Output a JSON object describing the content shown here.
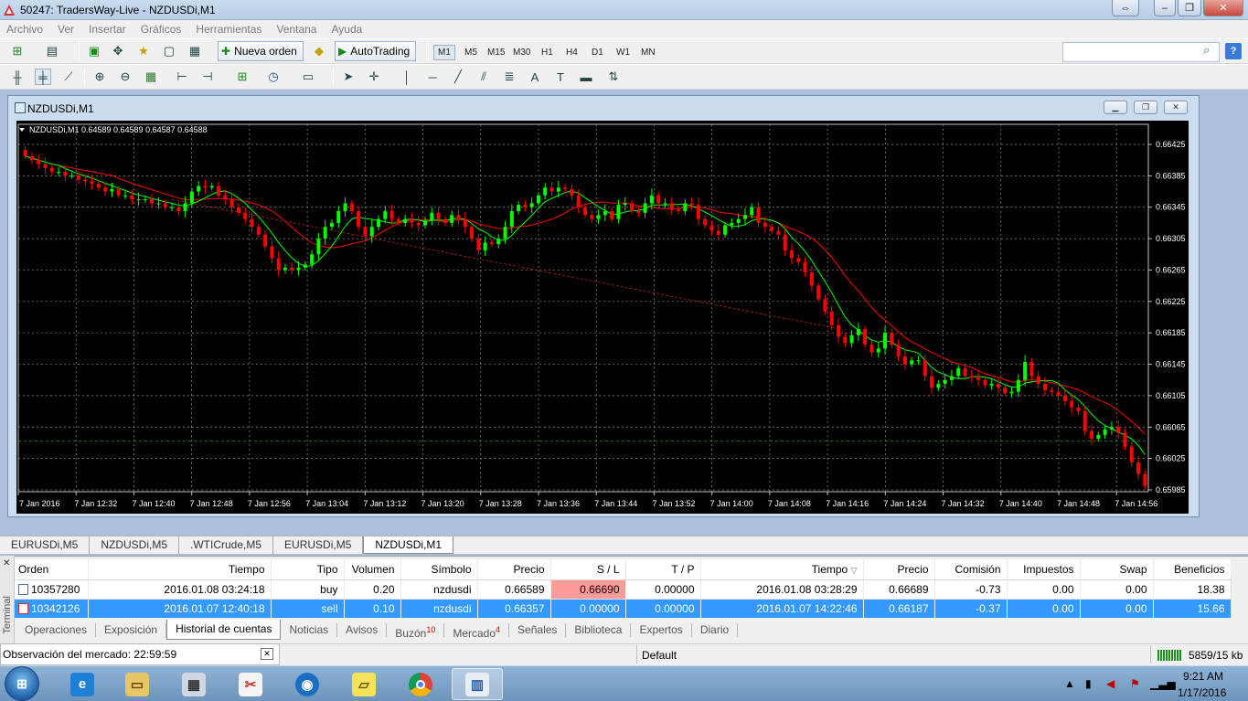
{
  "window": {
    "title": "50247: TradersWay-Live - NZDUSDi,M1"
  },
  "menu": [
    "Archivo",
    "Ver",
    "Insertar",
    "Gráficos",
    "Herramientas",
    "Ventana",
    "Ayuda"
  ],
  "toolbar": {
    "new_order": "Nueva orden",
    "autotrading": "AutoTrading",
    "timeframes": [
      "M1",
      "M5",
      "M15",
      "M30",
      "H1",
      "H4",
      "D1",
      "W1",
      "MN"
    ],
    "active_timeframe": "M1"
  },
  "chart_window": {
    "title": "NZDUSDi,M1"
  },
  "chart_data": {
    "type": "candlestick",
    "header": "NZDUSDi,M1  0.64589 0.64589 0.64587 0.64588",
    "symbol": "NZDUSDi,M1",
    "ohlc_shown": [
      0.64589,
      0.64589,
      0.64587,
      0.64588
    ],
    "y_ticks": [
      "0.66425",
      "0.66385",
      "0.66345",
      "0.66305",
      "0.66265",
      "0.66225",
      "0.66185",
      "0.66145",
      "0.66105",
      "0.66065",
      "0.66025",
      "0.65985"
    ],
    "ylim": [
      0.65985,
      0.66425
    ],
    "x_ticks": [
      "7 Jan 2016",
      "7 Jan 12:32",
      "7 Jan 12:40",
      "7 Jan 12:48",
      "7 Jan 12:56",
      "7 Jan 13:04",
      "7 Jan 13:12",
      "7 Jan 13:20",
      "7 Jan 13:28",
      "7 Jan 13:36",
      "7 Jan 13:44",
      "7 Jan 13:52",
      "7 Jan 14:00",
      "7 Jan 14:08",
      "7 Jan 14:16",
      "7 Jan 14:24",
      "7 Jan 14:32",
      "7 Jan 14:40",
      "7 Jan 14:48",
      "7 Jan 14:56"
    ],
    "close_series": [
      0.6641,
      0.66405,
      0.664,
      0.66395,
      0.6639,
      0.6639,
      0.66385,
      0.66385,
      0.6638,
      0.66378,
      0.66375,
      0.6637,
      0.66365,
      0.66368,
      0.6636,
      0.6636,
      0.66355,
      0.66355,
      0.66355,
      0.6635,
      0.6635,
      0.66345,
      0.66345,
      0.6634,
      0.6635,
      0.66365,
      0.66372,
      0.6637,
      0.66372,
      0.6636,
      0.66355,
      0.66345,
      0.66338,
      0.6633,
      0.6632,
      0.6631,
      0.66295,
      0.6628,
      0.66265,
      0.66268,
      0.66265,
      0.66268,
      0.66272,
      0.66285,
      0.66305,
      0.6632,
      0.66325,
      0.6634,
      0.6635,
      0.6634,
      0.6632,
      0.66308,
      0.6632,
      0.6633,
      0.6634,
      0.6633,
      0.66325,
      0.6633,
      0.66325,
      0.66322,
      0.66328,
      0.66338,
      0.6633,
      0.66325,
      0.66335,
      0.6633,
      0.6632,
      0.66305,
      0.6629,
      0.663,
      0.66298,
      0.66305,
      0.6632,
      0.6634,
      0.66348,
      0.66345,
      0.6635,
      0.6636,
      0.6637,
      0.66365,
      0.6637,
      0.66368,
      0.6636,
      0.66345,
      0.66335,
      0.6633,
      0.66335,
      0.6634,
      0.6633,
      0.66348,
      0.6635,
      0.6634,
      0.66338,
      0.6635,
      0.6636,
      0.6635,
      0.6635,
      0.66342,
      0.6634,
      0.6635,
      0.66348,
      0.6633,
      0.66322,
      0.66315,
      0.6631,
      0.66322,
      0.66325,
      0.6633,
      0.66335,
      0.66345,
      0.66325,
      0.6632,
      0.66315,
      0.6631,
      0.6629,
      0.6628,
      0.66275,
      0.66262,
      0.66245,
      0.66228,
      0.66212,
      0.66195,
      0.6618,
      0.66172,
      0.66182,
      0.6619,
      0.6617,
      0.6616,
      0.66165,
      0.66185,
      0.6617,
      0.66155,
      0.66145,
      0.6615,
      0.6615,
      0.6613,
      0.66115,
      0.6612,
      0.66125,
      0.6613,
      0.6614,
      0.6613,
      0.66128,
      0.66125,
      0.66118,
      0.6612,
      0.66115,
      0.66108,
      0.6611,
      0.66125,
      0.66148,
      0.6613,
      0.6612,
      0.66112,
      0.6611,
      0.66105,
      0.66098,
      0.6609,
      0.66085,
      0.6606,
      0.6605,
      0.66055,
      0.66062,
      0.66065,
      0.66058,
      0.6604,
      0.6602,
      0.66005,
      0.6599
    ],
    "fast_ma_color": "#00ff00",
    "slow_ma_color": "#ff0000",
    "up_color": "#00ff00",
    "down_color": "#ff0000",
    "grid": true
  },
  "chart_tabs": [
    "EURUSDi,M5",
    "NZDUSDi,M5",
    ".WTICrude,M5",
    "EURUSDi,M5",
    "NZDUSDi,M1"
  ],
  "active_chart_tab": "NZDUSDi,M1",
  "terminal": {
    "side_label": "Terminal",
    "columns": [
      "Orden",
      "Tiempo",
      "Tipo",
      "Volumen",
      "Símbolo",
      "Precio",
      "S / L",
      "T / P",
      "Tiempo",
      "Precio",
      "Comisión",
      "Impuestos",
      "Swap",
      "Beneficios"
    ],
    "rows": [
      [
        "10357280",
        "2016.01.08 03:24:18",
        "buy",
        "0.20",
        "nzdusdi",
        "0.66589",
        "0.66690",
        "0.00000",
        "2016.01.08 03:28:29",
        "0.66689",
        "-0.73",
        "0.00",
        "0.00",
        "18.38"
      ],
      [
        "10342126",
        "2016.01.07 12:40:18",
        "sell",
        "0.10",
        "nzdusdi",
        "0.66357",
        "0.00000",
        "0.00000",
        "2016.01.07 14:22:46",
        "0.66187",
        "-0.37",
        "0.00",
        "0.00",
        "15.66"
      ]
    ],
    "tabs": [
      "Operaciones",
      "Exposición",
      "Historial de cuentas",
      "Noticias",
      "Avisos",
      "Buzón",
      "Mercado",
      "Señales",
      "Biblioteca",
      "Expertos",
      "Diario"
    ],
    "buzon_count": "10",
    "mercado_count": "4"
  },
  "status": {
    "market_watch": "Observación del mercado: 22:59:59",
    "profile": "Default",
    "network": "5859/15 kb"
  },
  "taskbar": {
    "time": "9:21 AM",
    "date": "1/17/2016"
  }
}
